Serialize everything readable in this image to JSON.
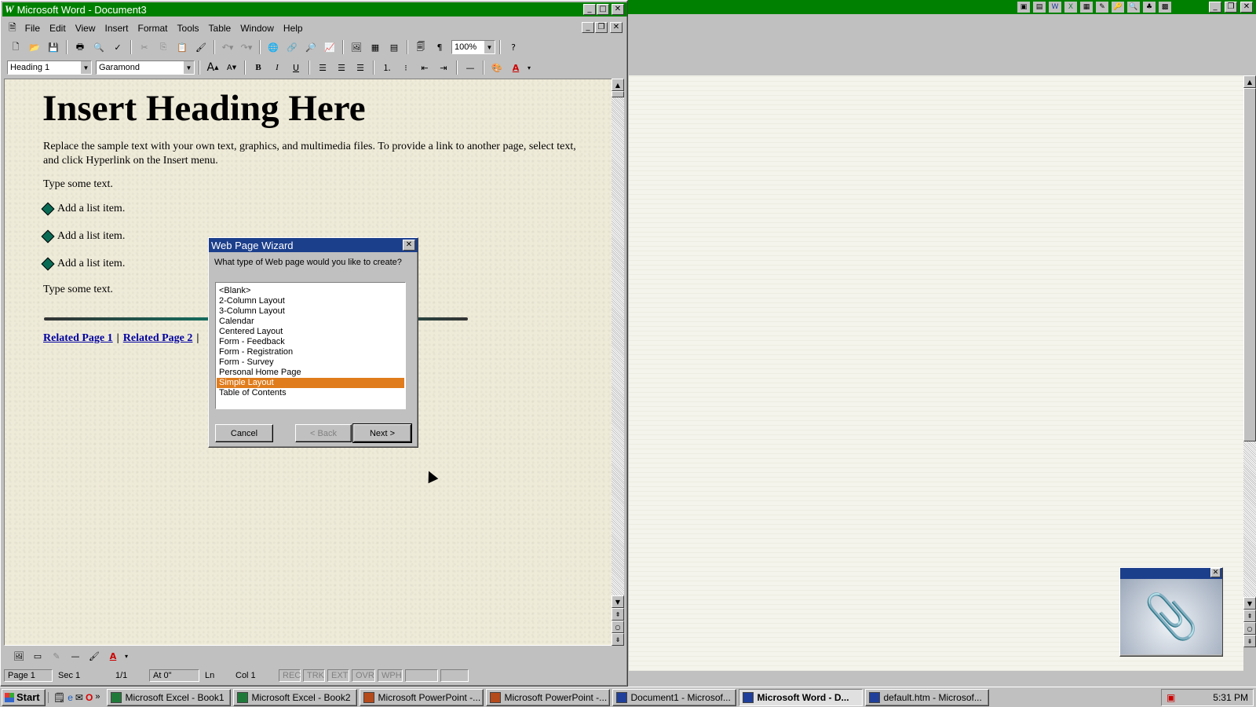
{
  "word": {
    "title": "Microsoft Word - Document3",
    "menu": [
      "File",
      "Edit",
      "View",
      "Insert",
      "Format",
      "Tools",
      "Table",
      "Window",
      "Help"
    ],
    "zoom": "100%",
    "style_value": "Heading 1",
    "font_value": "Garamond",
    "document": {
      "heading": "Insert Heading Here",
      "intro": "Replace the sample text with your own text, graphics, and multimedia files. To provide a link to another page, select text, and click Hyperlink on the Insert menu.",
      "type_text_1": "Type some text.",
      "list_items": [
        "Add a list item.",
        "Add a list item.",
        "Add a list item."
      ],
      "type_text_2": "Type some text.",
      "link1": "Related Page 1",
      "link2": "Related Page 2",
      "sep": "|"
    },
    "status": {
      "page": "Page 1",
      "sec": "Sec 1",
      "pages": "1/1",
      "at": "At 0\"",
      "ln": "Ln",
      "col": "Col 1",
      "rec": "REC",
      "trk": "TRK",
      "ext": "EXT",
      "ovr": "OVR",
      "wph": "WPH"
    }
  },
  "wizard": {
    "title": "Web Page Wizard",
    "question": "What type of Web page would you like to create?",
    "options": [
      "<Blank>",
      "2-Column Layout",
      "3-Column Layout",
      "Calendar",
      "Centered Layout",
      "Form - Feedback",
      "Form - Registration",
      "Form - Survey",
      "Personal Home Page",
      "Simple Layout",
      "Table of Contents"
    ],
    "selected": "Simple Layout",
    "cancel": "Cancel",
    "back": "< Back",
    "next": "Next >"
  },
  "taskbar": {
    "start": "Start",
    "tasks": [
      {
        "label": "Microsoft Excel - Book1",
        "color": "#1f7a3a"
      },
      {
        "label": "Microsoft Excel - Book2",
        "color": "#1f7a3a"
      },
      {
        "label": "Microsoft PowerPoint -...",
        "color": "#b54a1b"
      },
      {
        "label": "Microsoft PowerPoint -...",
        "color": "#b54a1b"
      },
      {
        "label": "Document1 - Microsof...",
        "color": "#1f3f9a"
      },
      {
        "label": "Microsoft Word - D...",
        "color": "#1f3f9a"
      },
      {
        "label": "default.htm - Microsof...",
        "color": "#1f3f9a"
      }
    ],
    "active_task": "Microsoft Word - D...",
    "clock": "5:31 PM"
  },
  "colors": {
    "titlebar": "#008000",
    "dialog_title": "#1c3f8c",
    "selection": "#e07c1c",
    "link": "#0000a0"
  }
}
